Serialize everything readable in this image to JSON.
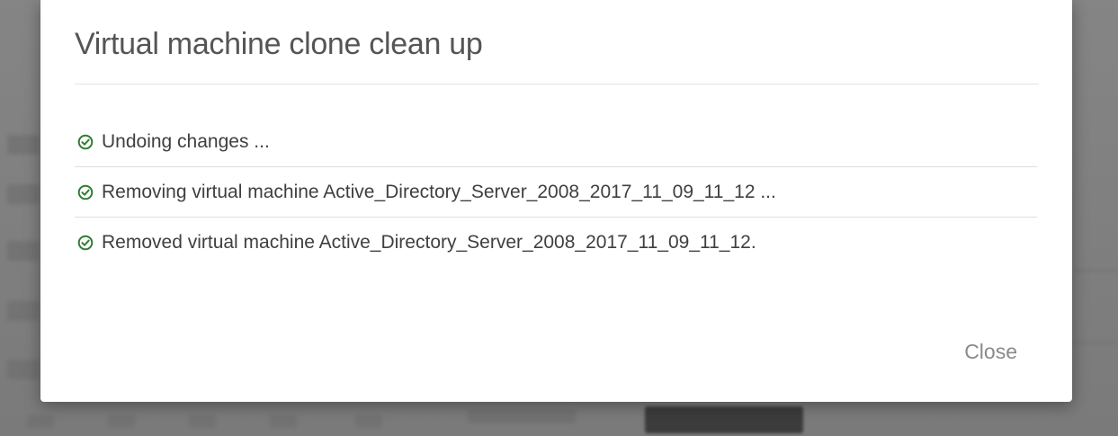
{
  "dialog": {
    "title": "Virtual machine clone clean up",
    "close_label": "Close"
  },
  "steps": [
    {
      "text": "Undoing changes ...",
      "status": "done",
      "icon": "check-circle-icon"
    },
    {
      "text": "Removing virtual machine Active_Directory_Server_2008_2017_11_09_11_12 ...",
      "status": "done",
      "icon": "check-circle-icon"
    },
    {
      "text": "Removed virtual machine Active_Directory_Server_2008_2017_11_09_11_12.",
      "status": "done",
      "icon": "check-circle-icon"
    }
  ],
  "colors": {
    "success": "#2e7d32",
    "title": "#555555",
    "text": "#3f3f3f",
    "close": "#8a8a8a",
    "overlay": "#7c7c7c"
  }
}
